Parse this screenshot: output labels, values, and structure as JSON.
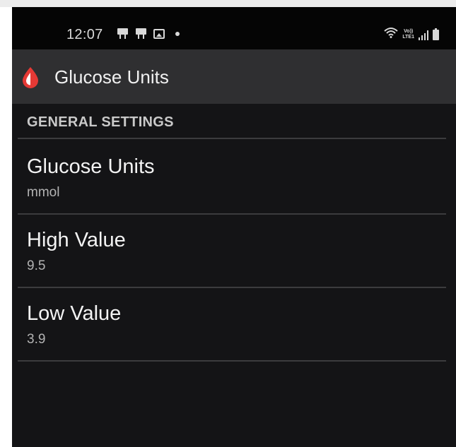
{
  "status_bar": {
    "time": "12:07",
    "notification_icons": [
      "notification-icon",
      "notification-icon",
      "image-icon",
      "dot-icon"
    ],
    "right_icons": [
      "wifi-icon",
      "volte-lte-icon",
      "signal-icon",
      "battery-icon"
    ],
    "lte_line1": "Vo))",
    "lte_line2": "LTE1"
  },
  "app_bar": {
    "title": "Glucose Units",
    "icon": "blood-drop-icon",
    "icon_color": "#e53935"
  },
  "section": {
    "header": "GENERAL SETTINGS"
  },
  "preferences": [
    {
      "title": "Glucose Units",
      "summary": "mmol"
    },
    {
      "title": "High Value",
      "summary": "9.5"
    },
    {
      "title": "Low Value",
      "summary": "3.9"
    }
  ],
  "colors": {
    "background": "#141416",
    "app_bar": "#2f2f31",
    "status_bar": "#050505",
    "accent": "#e53935"
  }
}
